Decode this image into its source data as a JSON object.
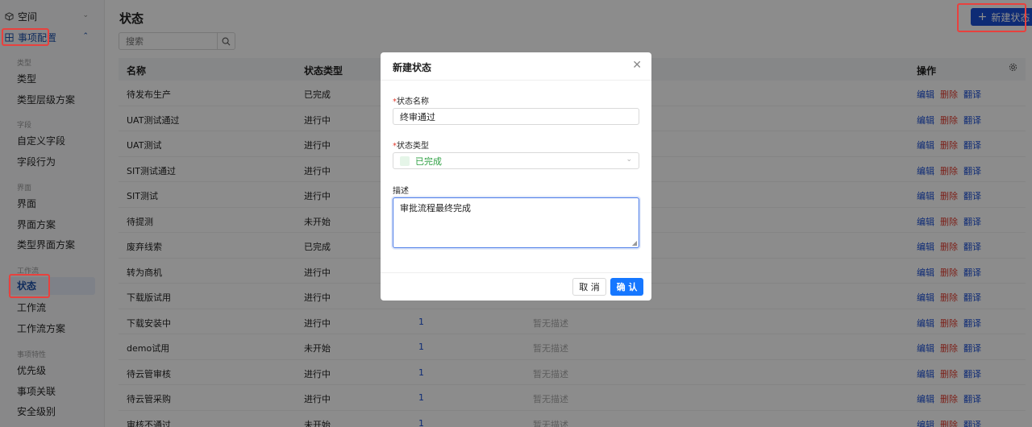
{
  "sidebar": {
    "space": "空间",
    "config": "事项配置",
    "groups": {
      "type": "类型",
      "field": "字段",
      "screen": "界面",
      "workflow": "工作流",
      "feature": "事项特性"
    },
    "items": {
      "type": "类型",
      "type_hierarchy": "类型层级方案",
      "custom_field": "自定义字段",
      "field_behavior": "字段行为",
      "screen": "界面",
      "screen_scheme": "界面方案",
      "type_screen_scheme": "类型界面方案",
      "status": "状态",
      "workflow": "工作流",
      "workflow_scheme": "工作流方案",
      "priority": "优先级",
      "issue_link": "事项关联",
      "security_level": "安全级别"
    }
  },
  "header": {
    "title": "状态",
    "new_button": "新建状态",
    "search_placeholder": "搜索"
  },
  "table": {
    "columns": {
      "name": "名称",
      "type": "状态类型",
      "actions": "操作"
    },
    "actions": {
      "edit": "编辑",
      "delete": "删除",
      "translate": "翻译"
    },
    "rows": [
      {
        "name": "待发布生产",
        "type": "已完成",
        "count": "",
        "desc": ""
      },
      {
        "name": "UAT测试通过",
        "type": "进行中",
        "count": "",
        "desc": ""
      },
      {
        "name": "UAT测试",
        "type": "进行中",
        "count": "",
        "desc": ""
      },
      {
        "name": "SIT测试通过",
        "type": "进行中",
        "count": "",
        "desc": ""
      },
      {
        "name": "SIT测试",
        "type": "进行中",
        "count": "",
        "desc": ""
      },
      {
        "name": "待提测",
        "type": "未开始",
        "count": "",
        "desc": ""
      },
      {
        "name": "废弃线索",
        "type": "已完成",
        "count": "",
        "desc": ""
      },
      {
        "name": "转为商机",
        "type": "进行中",
        "count": "",
        "desc": ""
      },
      {
        "name": "下载版试用",
        "type": "进行中",
        "count": "",
        "desc": ""
      },
      {
        "name": "下载安装中",
        "type": "进行中",
        "count": "1",
        "desc": "暂无描述"
      },
      {
        "name": "demo试用",
        "type": "未开始",
        "count": "1",
        "desc": "暂无描述"
      },
      {
        "name": "待云管审核",
        "type": "进行中",
        "count": "1",
        "desc": "暂无描述"
      },
      {
        "name": "待云管采购",
        "type": "进行中",
        "count": "1",
        "desc": "暂无描述"
      },
      {
        "name": "审核不通过",
        "type": "未开始",
        "count": "1",
        "desc": "暂无描述"
      }
    ]
  },
  "modal": {
    "title": "新建状态",
    "name_label": "状态名称",
    "name_value": "终审通过",
    "type_label": "状态类型",
    "type_value": "已完成",
    "desc_label": "描述",
    "desc_value": "审批流程最终完成",
    "required_mark": "*",
    "cancel": "取 消",
    "confirm": "确 认"
  },
  "colors": {
    "primary": "#1b4fd6",
    "danger": "#e23b2e",
    "done_green": "#2ea043",
    "highlight_red": "#e8413e"
  }
}
